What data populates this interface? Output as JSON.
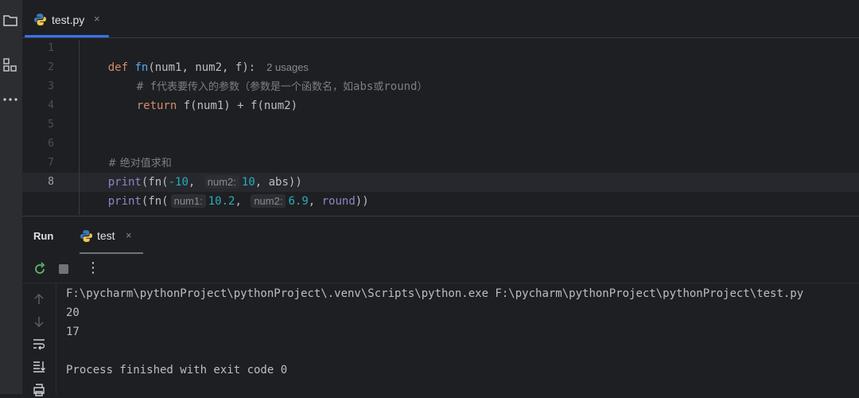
{
  "toolstrip": {
    "icons": [
      "folder-icon",
      "structure-icon",
      "more-icon"
    ]
  },
  "editor_tab": {
    "filename": "test.py",
    "close_glyph": "×"
  },
  "editor": {
    "line_numbers": [
      "1",
      "2",
      "3",
      "4",
      "5",
      "6",
      "7",
      "8"
    ],
    "current_line": 8,
    "line1": {
      "kw": "def",
      "name": "fn",
      "rest": "(num1, num2, f):",
      "usages": "2 usages"
    },
    "line2": {
      "comment_prefix": "# f",
      "comment_cn": "代表要传入的参数（参数是一个函数名，如",
      "abs": "abs",
      "cn2": "或",
      "round": "round",
      "cn3": "）"
    },
    "line3": {
      "kw": "return",
      "rest": " f(num1) + f(num2)"
    },
    "line6": {
      "comment": "# 绝对值求和"
    },
    "line7": {
      "call": "print",
      "open": "(fn(",
      "arg1": "-10",
      "comma1": ",",
      "hint2": "num2:",
      "arg2": "10",
      "rest": ", abs))"
    },
    "line8": {
      "call": "print",
      "open": "(fn(",
      "hint1": "num1:",
      "arg1": "10.2",
      "comma1": ",",
      "hint2": "num2:",
      "arg2": "6.9",
      "rest_pre": ", ",
      "round": "round",
      "rest": "))"
    }
  },
  "run_panel": {
    "title": "Run",
    "tab_label": "test",
    "close_glyph": "×",
    "more_glyph": "⋮",
    "console": [
      "F:\\pycharm\\pythonProject\\pythonProject\\.venv\\Scripts\\python.exe F:\\pycharm\\pythonProject\\pythonProject\\test.py",
      "20",
      "17",
      "",
      "Process finished with exit code 0"
    ]
  },
  "colors": {
    "background": "#1e1f22",
    "keyword": "#cf8e6d",
    "function": "#56a8f5",
    "number": "#2aacb8",
    "builtin": "#8888c6",
    "comment": "#7a7e85",
    "accent": "#3574f0",
    "run_green": "#5fb865"
  }
}
